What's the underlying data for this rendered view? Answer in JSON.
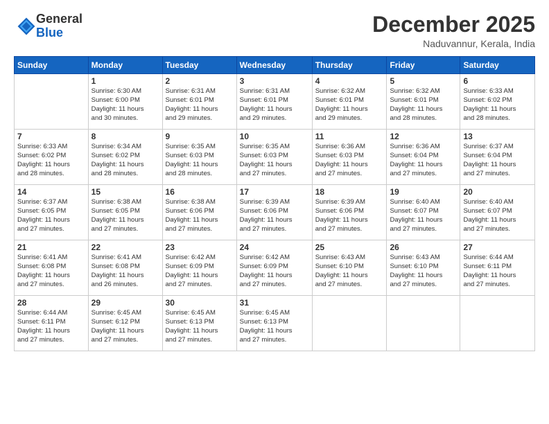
{
  "logo": {
    "line1": "General",
    "line2": "Blue"
  },
  "title": "December 2025",
  "location": "Naduvannur, Kerala, India",
  "headers": [
    "Sunday",
    "Monday",
    "Tuesday",
    "Wednesday",
    "Thursday",
    "Friday",
    "Saturday"
  ],
  "weeks": [
    [
      {
        "day": "",
        "info": ""
      },
      {
        "day": "1",
        "info": "Sunrise: 6:30 AM\nSunset: 6:00 PM\nDaylight: 11 hours\nand 30 minutes."
      },
      {
        "day": "2",
        "info": "Sunrise: 6:31 AM\nSunset: 6:01 PM\nDaylight: 11 hours\nand 29 minutes."
      },
      {
        "day": "3",
        "info": "Sunrise: 6:31 AM\nSunset: 6:01 PM\nDaylight: 11 hours\nand 29 minutes."
      },
      {
        "day": "4",
        "info": "Sunrise: 6:32 AM\nSunset: 6:01 PM\nDaylight: 11 hours\nand 29 minutes."
      },
      {
        "day": "5",
        "info": "Sunrise: 6:32 AM\nSunset: 6:01 PM\nDaylight: 11 hours\nand 28 minutes."
      },
      {
        "day": "6",
        "info": "Sunrise: 6:33 AM\nSunset: 6:02 PM\nDaylight: 11 hours\nand 28 minutes."
      }
    ],
    [
      {
        "day": "7",
        "info": "Sunrise: 6:33 AM\nSunset: 6:02 PM\nDaylight: 11 hours\nand 28 minutes."
      },
      {
        "day": "8",
        "info": "Sunrise: 6:34 AM\nSunset: 6:02 PM\nDaylight: 11 hours\nand 28 minutes."
      },
      {
        "day": "9",
        "info": "Sunrise: 6:35 AM\nSunset: 6:03 PM\nDaylight: 11 hours\nand 28 minutes."
      },
      {
        "day": "10",
        "info": "Sunrise: 6:35 AM\nSunset: 6:03 PM\nDaylight: 11 hours\nand 27 minutes."
      },
      {
        "day": "11",
        "info": "Sunrise: 6:36 AM\nSunset: 6:03 PM\nDaylight: 11 hours\nand 27 minutes."
      },
      {
        "day": "12",
        "info": "Sunrise: 6:36 AM\nSunset: 6:04 PM\nDaylight: 11 hours\nand 27 minutes."
      },
      {
        "day": "13",
        "info": "Sunrise: 6:37 AM\nSunset: 6:04 PM\nDaylight: 11 hours\nand 27 minutes."
      }
    ],
    [
      {
        "day": "14",
        "info": "Sunrise: 6:37 AM\nSunset: 6:05 PM\nDaylight: 11 hours\nand 27 minutes."
      },
      {
        "day": "15",
        "info": "Sunrise: 6:38 AM\nSunset: 6:05 PM\nDaylight: 11 hours\nand 27 minutes."
      },
      {
        "day": "16",
        "info": "Sunrise: 6:38 AM\nSunset: 6:06 PM\nDaylight: 11 hours\nand 27 minutes."
      },
      {
        "day": "17",
        "info": "Sunrise: 6:39 AM\nSunset: 6:06 PM\nDaylight: 11 hours\nand 27 minutes."
      },
      {
        "day": "18",
        "info": "Sunrise: 6:39 AM\nSunset: 6:06 PM\nDaylight: 11 hours\nand 27 minutes."
      },
      {
        "day": "19",
        "info": "Sunrise: 6:40 AM\nSunset: 6:07 PM\nDaylight: 11 hours\nand 27 minutes."
      },
      {
        "day": "20",
        "info": "Sunrise: 6:40 AM\nSunset: 6:07 PM\nDaylight: 11 hours\nand 27 minutes."
      }
    ],
    [
      {
        "day": "21",
        "info": "Sunrise: 6:41 AM\nSunset: 6:08 PM\nDaylight: 11 hours\nand 27 minutes."
      },
      {
        "day": "22",
        "info": "Sunrise: 6:41 AM\nSunset: 6:08 PM\nDaylight: 11 hours\nand 26 minutes."
      },
      {
        "day": "23",
        "info": "Sunrise: 6:42 AM\nSunset: 6:09 PM\nDaylight: 11 hours\nand 27 minutes."
      },
      {
        "day": "24",
        "info": "Sunrise: 6:42 AM\nSunset: 6:09 PM\nDaylight: 11 hours\nand 27 minutes."
      },
      {
        "day": "25",
        "info": "Sunrise: 6:43 AM\nSunset: 6:10 PM\nDaylight: 11 hours\nand 27 minutes."
      },
      {
        "day": "26",
        "info": "Sunrise: 6:43 AM\nSunset: 6:10 PM\nDaylight: 11 hours\nand 27 minutes."
      },
      {
        "day": "27",
        "info": "Sunrise: 6:44 AM\nSunset: 6:11 PM\nDaylight: 11 hours\nand 27 minutes."
      }
    ],
    [
      {
        "day": "28",
        "info": "Sunrise: 6:44 AM\nSunset: 6:11 PM\nDaylight: 11 hours\nand 27 minutes."
      },
      {
        "day": "29",
        "info": "Sunrise: 6:45 AM\nSunset: 6:12 PM\nDaylight: 11 hours\nand 27 minutes."
      },
      {
        "day": "30",
        "info": "Sunrise: 6:45 AM\nSunset: 6:13 PM\nDaylight: 11 hours\nand 27 minutes."
      },
      {
        "day": "31",
        "info": "Sunrise: 6:45 AM\nSunset: 6:13 PM\nDaylight: 11 hours\nand 27 minutes."
      },
      {
        "day": "",
        "info": ""
      },
      {
        "day": "",
        "info": ""
      },
      {
        "day": "",
        "info": ""
      }
    ]
  ]
}
